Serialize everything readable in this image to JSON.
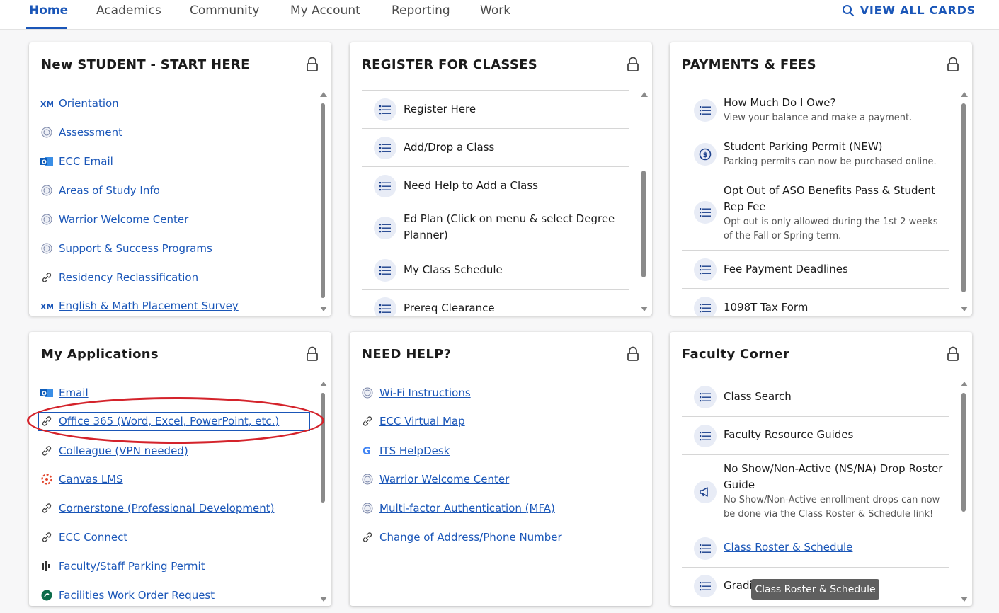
{
  "nav": {
    "tabs": [
      "Home",
      "Academics",
      "Community",
      "My Account",
      "Reporting",
      "Work"
    ],
    "view_all": "VIEW ALL CARDS"
  },
  "cards": {
    "new_student": {
      "title": "New STUDENT - START HERE",
      "links": [
        {
          "label": "Orientation",
          "icon": "xm-icon"
        },
        {
          "label": "Assessment",
          "icon": "seal-icon"
        },
        {
          "label": "ECC Email",
          "icon": "outlook-icon"
        },
        {
          "label": "Areas of Study Info",
          "icon": "seal-icon"
        },
        {
          "label": "Warrior Welcome Center",
          "icon": "seal-icon"
        },
        {
          "label": "Support & Success Programs",
          "icon": "seal-icon"
        },
        {
          "label": "Residency Reclassification",
          "icon": "link-icon"
        },
        {
          "label": "English & Math Placement Survey",
          "icon": "xm-icon"
        }
      ]
    },
    "register": {
      "title": "REGISTER FOR CLASSES",
      "items": [
        "Register Here",
        "Add/Drop a Class",
        "Need Help to Add a Class",
        "Ed Plan (Click on menu & select Degree Planner)",
        "My Class Schedule",
        "Prereq Clearance"
      ]
    },
    "payments": {
      "title": "PAYMENTS & FEES",
      "items": [
        {
          "label": "How Much Do I Owe?",
          "sub": "View your balance and make a payment.",
          "icon": "list-icon"
        },
        {
          "label": "Student Parking Permit (NEW)",
          "sub": "Parking permits can now be purchased online.",
          "icon": "dollar-icon"
        },
        {
          "label": "Opt Out of ASO Benefits Pass & Student Rep Fee",
          "sub": "Opt out is only allowed during the 1st 2 weeks of the Fall or Spring term.",
          "icon": "list-icon"
        },
        {
          "label": "Fee Payment Deadlines",
          "sub": "",
          "icon": "list-icon"
        },
        {
          "label": "1098T Tax Form",
          "sub": "",
          "icon": "list-icon"
        }
      ]
    },
    "my_apps": {
      "title": "My Applications",
      "links": [
        {
          "label": "Email",
          "icon": "outlook-icon"
        },
        {
          "label": "Office 365 (Word, Excel, PowerPoint, etc.)",
          "icon": "link-icon"
        },
        {
          "label": "Colleague (VPN needed)",
          "icon": "link-icon"
        },
        {
          "label": "Canvas LMS",
          "icon": "canvas-icon"
        },
        {
          "label": "Cornerstone (Professional Development)",
          "icon": "link-icon"
        },
        {
          "label": "ECC Connect",
          "icon": "link-icon"
        },
        {
          "label": "Faculty/Staff Parking Permit",
          "icon": "parking-icon"
        },
        {
          "label": "Facilities Work Order Request",
          "icon": "facilities-icon"
        }
      ]
    },
    "need_help": {
      "title": "NEED HELP?",
      "links": [
        {
          "label": "Wi-Fi Instructions",
          "icon": "seal-icon"
        },
        {
          "label": "ECC Virtual Map",
          "icon": "link-icon"
        },
        {
          "label": "ITS HelpDesk",
          "icon": "google-icon"
        },
        {
          "label": "Warrior Welcome Center",
          "icon": "seal-icon"
        },
        {
          "label": "Multi-factor Authentication (MFA)",
          "icon": "seal-icon"
        },
        {
          "label": "Change of Address/Phone Number",
          "icon": "link-icon"
        }
      ]
    },
    "faculty": {
      "title": "Faculty Corner",
      "items": [
        {
          "label": "Class Search",
          "sub": "",
          "icon": "list-icon"
        },
        {
          "label": "Faculty Resource Guides",
          "sub": "",
          "icon": "list-icon"
        },
        {
          "label": "No Show/Non-Active (NS/NA) Drop Roster Guide",
          "sub": "No Show/Non-Active enrollment drops can now be done via the Class Roster & Schedule link!",
          "icon": "megaphone-icon"
        },
        {
          "label": "Class Roster & Schedule",
          "sub": "",
          "icon": "list-icon"
        },
        {
          "label": "Gradi",
          "sub": "",
          "icon": "list-icon"
        }
      ]
    }
  },
  "tooltip": "Class Roster & Schedule",
  "colors": {
    "accent": "#1a56b8",
    "annotation": "#d4232b"
  }
}
